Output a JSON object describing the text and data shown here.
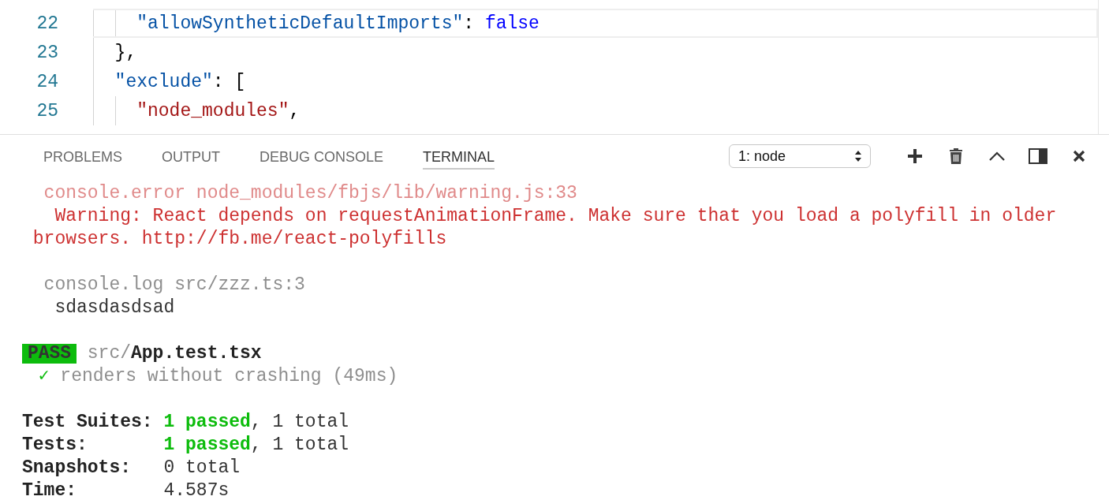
{
  "editor": {
    "lines": [
      {
        "number": "22",
        "current": true,
        "tokens": [
          {
            "kind": "key",
            "text": "    \"allowSyntheticDefaultImports\""
          },
          {
            "kind": "punct",
            "text": ": "
          },
          {
            "kind": "keyword",
            "text": "false"
          }
        ]
      },
      {
        "number": "23",
        "current": false,
        "tokens": [
          {
            "kind": "punct",
            "text": "  },"
          }
        ]
      },
      {
        "number": "24",
        "current": false,
        "tokens": [
          {
            "kind": "key",
            "text": "  \"exclude\""
          },
          {
            "kind": "punct",
            "text": ": ["
          }
        ]
      },
      {
        "number": "25",
        "current": false,
        "tokens": [
          {
            "kind": "string",
            "text": "    \"node_modules\""
          },
          {
            "kind": "punct",
            "text": ","
          }
        ]
      }
    ]
  },
  "panel": {
    "tabs": [
      {
        "label": "PROBLEMS",
        "selected": false
      },
      {
        "label": "OUTPUT",
        "selected": false
      },
      {
        "label": "DEBUG CONSOLE",
        "selected": false
      },
      {
        "label": "TERMINAL",
        "selected": true
      }
    ],
    "terminal_select": {
      "value": "1: node"
    }
  },
  "terminal": {
    "lines": [
      {
        "kind": "log-header",
        "text": "console.error node_modules/fbjs/lib/warning.js:33",
        "error": true
      },
      {
        "kind": "error-message",
        "text": "Warning: React depends on requestAnimationFrame. Make sure that you load a polyfill in older browsers. http://fb.me/react-polyfills"
      },
      {
        "kind": "blank"
      },
      {
        "kind": "log-header",
        "text": "console.log src/zzz.ts:3",
        "error": false
      },
      {
        "kind": "log-message",
        "text": "sdasdasdsad"
      },
      {
        "kind": "blank"
      },
      {
        "kind": "test-result",
        "badge": "PASS",
        "path": "src/",
        "file": "App.test.tsx"
      },
      {
        "kind": "test-case",
        "check": "✓",
        "text": "renders without crashing (49ms)"
      },
      {
        "kind": "blank"
      },
      {
        "kind": "summary",
        "label": "Test Suites:",
        "passed": "1 passed",
        "rest": ", 1 total"
      },
      {
        "kind": "summary",
        "label": "Tests:",
        "passed": "1 passed",
        "rest": ", 1 total"
      },
      {
        "kind": "summary",
        "label": "Snapshots:",
        "rest": "0 total"
      },
      {
        "kind": "summary",
        "label": "Time:",
        "rest": "4.587s"
      }
    ]
  }
}
